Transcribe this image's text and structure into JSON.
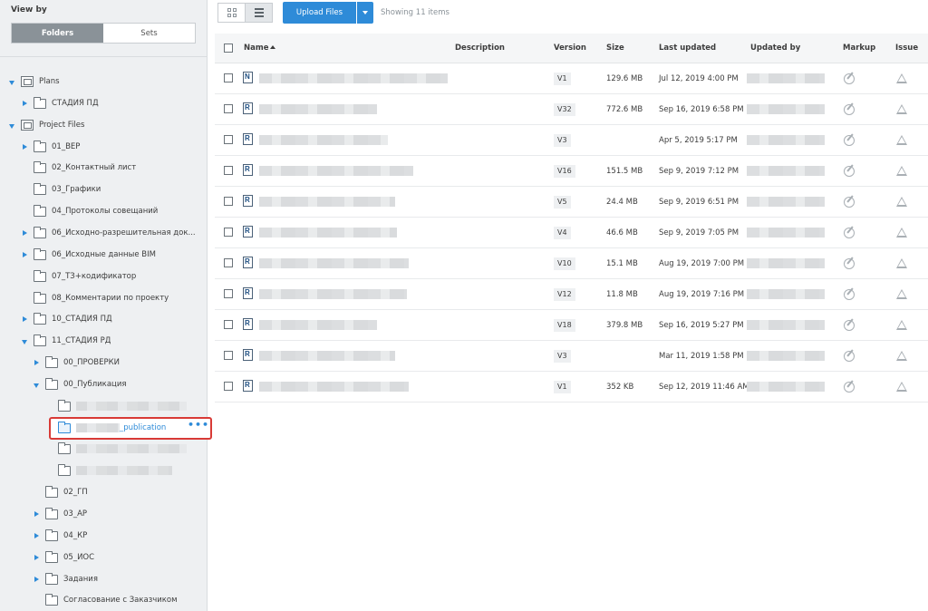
{
  "sidebar": {
    "view_by": "View by",
    "toggle": {
      "folders": "Folders",
      "sets": "Sets"
    },
    "tree": [
      {
        "label": "Plans",
        "level": 0,
        "caret": "down",
        "icon": "plans-icon"
      },
      {
        "label": "СТАДИЯ ПД",
        "level": 1,
        "caret": "right",
        "icon": "folder-icon"
      },
      {
        "label": "Project Files",
        "level": 0,
        "caret": "down",
        "icon": "project-files-icon"
      },
      {
        "label": "01_BEP",
        "level": 1,
        "caret": "right",
        "icon": "folder-icon"
      },
      {
        "label": "02_Контактный лист",
        "level": 1,
        "caret": "none",
        "icon": "folder-icon"
      },
      {
        "label": "03_Графики",
        "level": 1,
        "caret": "none",
        "icon": "folder-icon"
      },
      {
        "label": "04_Протоколы совещаний",
        "level": 1,
        "caret": "none",
        "icon": "folder-icon"
      },
      {
        "label": "06_Исходно-разрешительная док...",
        "level": 1,
        "caret": "right",
        "icon": "folder-icon"
      },
      {
        "label": "06_Исходные данные BIM",
        "level": 1,
        "caret": "right",
        "icon": "folder-icon"
      },
      {
        "label": "07_ТЗ+кодификатор",
        "level": 1,
        "caret": "none",
        "icon": "folder-icon"
      },
      {
        "label": "08_Комментарии по проекту",
        "level": 1,
        "caret": "none",
        "icon": "folder-icon"
      },
      {
        "label": "10_СТАДИЯ ПД",
        "level": 1,
        "caret": "right",
        "icon": "folder-icon"
      },
      {
        "label": "11_СТАДИЯ РД",
        "level": 1,
        "caret": "down",
        "icon": "folder-icon"
      },
      {
        "label": "00_ПРОВЕРКИ",
        "level": 2,
        "caret": "right",
        "icon": "folder-icon"
      },
      {
        "label": "00_Публикация",
        "level": 2,
        "caret": "down",
        "icon": "folder-icon"
      },
      {
        "label": "",
        "level": 3,
        "caret": "none",
        "icon": "folder-icon",
        "blurred": true
      },
      {
        "label": "_publication",
        "level": 3,
        "caret": "none",
        "icon": "folder-icon",
        "blurred": true,
        "selected": true
      },
      {
        "label": "",
        "level": 3,
        "caret": "none",
        "icon": "folder-icon",
        "blurred": true
      },
      {
        "label": "",
        "level": 3,
        "caret": "none",
        "icon": "folder-icon",
        "blurred": true
      },
      {
        "label": "02_ГП",
        "level": 2,
        "caret": "none",
        "icon": "folder-icon"
      },
      {
        "label": "03_АР",
        "level": 2,
        "caret": "right",
        "icon": "folder-icon"
      },
      {
        "label": "04_КР",
        "level": 2,
        "caret": "right",
        "icon": "folder-icon"
      },
      {
        "label": "05_ИОС",
        "level": 2,
        "caret": "right",
        "icon": "folder-icon"
      },
      {
        "label": "Задания",
        "level": 2,
        "caret": "right",
        "icon": "folder-icon"
      },
      {
        "label": "Согласование с Заказчиком",
        "level": 2,
        "caret": "none",
        "icon": "folder-icon"
      }
    ],
    "more_actions": "•••"
  },
  "toolbar": {
    "upload_label": "Upload Files",
    "showing": "Showing 11 items"
  },
  "table": {
    "headers": {
      "name": "Name",
      "description": "Description",
      "version": "Version",
      "size": "Size",
      "last_updated": "Last updated",
      "updated_by": "Updated by",
      "markup": "Markup",
      "issue": "Issue"
    },
    "rows": [
      {
        "icon": "N",
        "version": "V1",
        "size": "129.6 MB",
        "updated": "Jul 12, 2019 4:00 PM"
      },
      {
        "icon": "R",
        "version": "V32",
        "size": "772.6 MB",
        "updated": "Sep 16, 2019 6:58 PM"
      },
      {
        "icon": "R",
        "version": "V3",
        "size": "",
        "updated": "Apr 5, 2019 5:17 PM"
      },
      {
        "icon": "R",
        "version": "V16",
        "size": "151.5 MB",
        "updated": "Sep 9, 2019 7:12 PM"
      },
      {
        "icon": "R",
        "version": "V5",
        "size": "24.4 MB",
        "updated": "Sep 9, 2019 6:51 PM"
      },
      {
        "icon": "R",
        "version": "V4",
        "size": "46.6 MB",
        "updated": "Sep 9, 2019 7:05 PM"
      },
      {
        "icon": "R",
        "version": "V10",
        "size": "15.1 MB",
        "updated": "Aug 19, 2019 7:00 PM"
      },
      {
        "icon": "R",
        "version": "V12",
        "size": "11.8 MB",
        "updated": "Aug 19, 2019 7:16 PM"
      },
      {
        "icon": "R",
        "version": "V18",
        "size": "379.8 MB",
        "updated": "Sep 16, 2019 5:27 PM"
      },
      {
        "icon": "R",
        "version": "V3",
        "size": "",
        "updated": "Mar 11, 2019 1:58 PM"
      },
      {
        "icon": "R",
        "version": "V1",
        "size": "352 KB",
        "updated": "Sep 12, 2019 11:46 AM"
      }
    ]
  },
  "colors": {
    "accent": "#2e8bd8",
    "highlight": "#d83a36",
    "sidebar_bg": "#eef0f2"
  }
}
